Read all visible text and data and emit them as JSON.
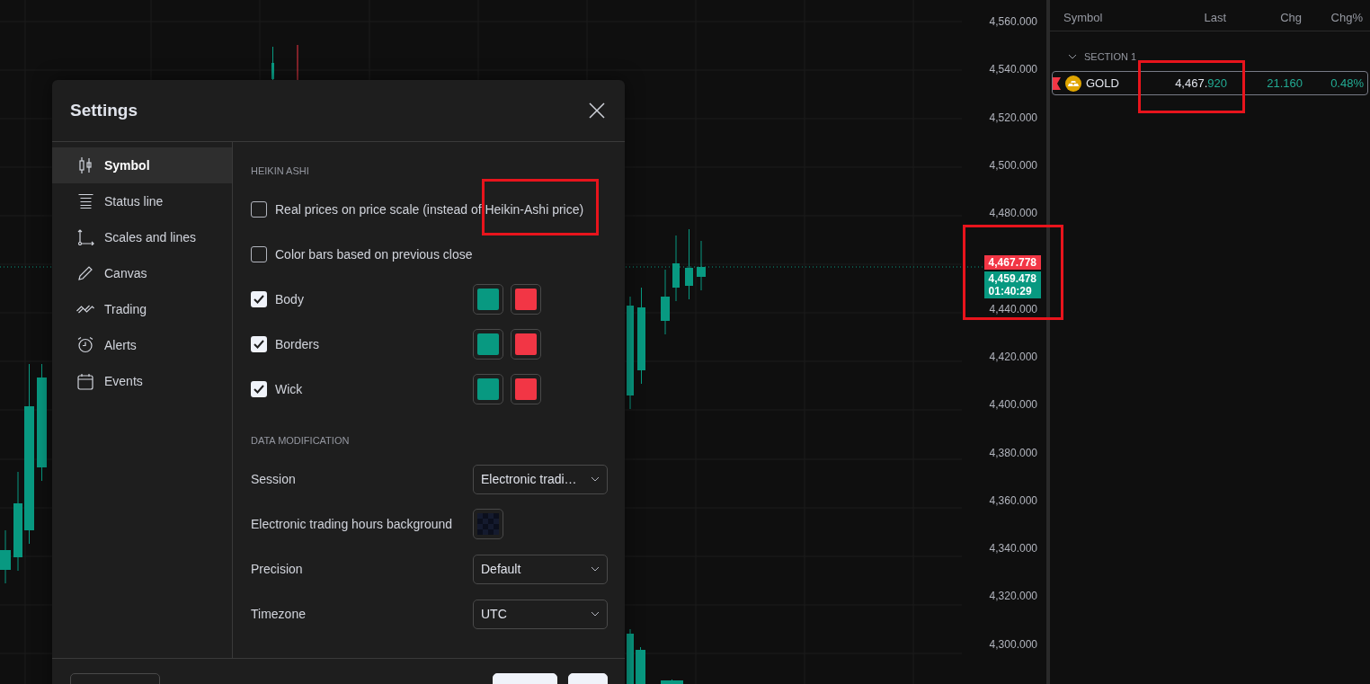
{
  "price_scale": {
    "ticks_above": [
      "4,560.000",
      "4,540.000",
      "4,520.000",
      "4,500.000",
      "4,480.000"
    ],
    "tags": [
      {
        "kind": "price",
        "text": "4,467.778",
        "color": "#f23645"
      },
      {
        "kind": "countdown",
        "text": "4,459.478",
        "sub": "01:40:29",
        "color": "#089981"
      }
    ],
    "tags_highlighted": true,
    "ticks_below": [
      "4,440.000",
      "4,420.000",
      "4,400.000",
      "4,380.000",
      "4,360.000",
      "4,340.000",
      "4,320.000",
      "4,300.000"
    ]
  },
  "watchlist": {
    "columns": [
      "Symbol",
      "Last",
      "Chg",
      "Chg%"
    ],
    "section": {
      "title": "SECTION 1",
      "expanded": true
    },
    "rows": [
      {
        "symbol": "GOLD",
        "last": "4,467.",
        "last_tail": "920",
        "change": "21.160",
        "change_pct": "0.48%",
        "selected": true,
        "last_highlighted": true
      }
    ]
  },
  "dialog": {
    "title": "Settings",
    "nav": [
      {
        "label": "Symbol",
        "selected": true
      },
      {
        "label": "Status line",
        "selected": false
      },
      {
        "label": "Scales and lines",
        "selected": false
      },
      {
        "label": "Canvas",
        "selected": false
      },
      {
        "label": "Trading",
        "selected": false
      },
      {
        "label": "Alerts",
        "selected": false
      },
      {
        "label": "Events",
        "selected": false
      }
    ],
    "sections": [
      {
        "title": "HEIKIN ASHI",
        "rows": [
          {
            "kind": "checkbox",
            "label": "Real prices on price scale (instead of Heikin-Ashi price)",
            "checked": false,
            "highlighted": true
          },
          {
            "kind": "checkbox",
            "label": "Color bars based on previous close",
            "checked": false
          },
          {
            "kind": "colors",
            "label": "Body",
            "checked": true
          },
          {
            "kind": "colors",
            "label": "Borders",
            "checked": true
          },
          {
            "kind": "colors",
            "label": "Wick",
            "checked": true
          }
        ]
      },
      {
        "title": "DATA MODIFICATION",
        "rows": [
          {
            "kind": "select",
            "label": "Session",
            "value": "Electronic tradi…"
          },
          {
            "kind": "pattern",
            "label": "Electronic trading hours background"
          },
          {
            "kind": "select",
            "label": "Precision",
            "value": "Default"
          },
          {
            "kind": "select",
            "label": "Timezone",
            "value": "UTC"
          }
        ]
      }
    ],
    "footer": [
      {
        "kind": "outline"
      },
      {
        "kind": "solid"
      },
      {
        "kind": "solid"
      }
    ]
  }
}
